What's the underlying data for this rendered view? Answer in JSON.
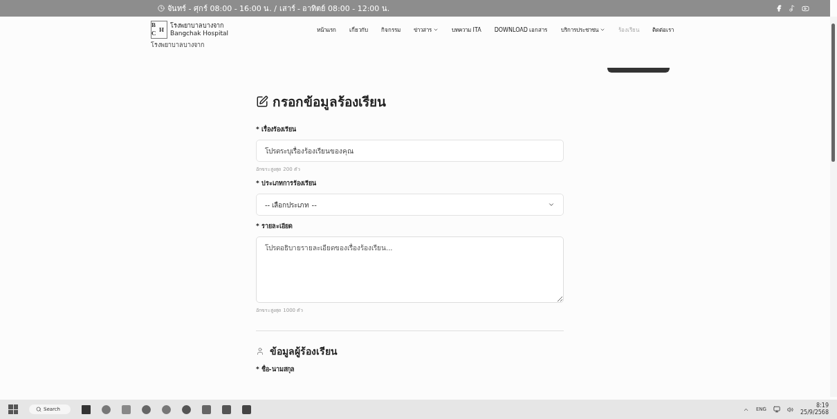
{
  "top_bar": {
    "hours": "จันทร์ - ศุกร์ 08:00 - 16:00 น. / เสาร์ - อาทิตย์ 08:00 - 12:00 น."
  },
  "logo": {
    "mark_top": "B",
    "mark_bottom": "C",
    "mark_side": "H",
    "name_th": "โรงพยาบาลบางจาก",
    "name_en": "Bangchak Hospital"
  },
  "nav": [
    {
      "label": "หน้าแรก",
      "dropdown": false,
      "selected": false
    },
    {
      "label": "เกี่ยวกับ",
      "dropdown": false,
      "selected": false
    },
    {
      "label": "กิจกรรม",
      "dropdown": false,
      "selected": false
    },
    {
      "label": "ข่าวสาร",
      "dropdown": true,
      "selected": false
    },
    {
      "label": "บทความ ITA",
      "dropdown": false,
      "selected": false
    },
    {
      "label": "DOWNLOAD เอกสาร",
      "dropdown": false,
      "selected": false
    },
    {
      "label": "บริการประชาชน",
      "dropdown": true,
      "selected": false
    },
    {
      "label": "ร้องเรียน",
      "dropdown": false,
      "selected": true
    },
    {
      "label": "ติดต่อเรา",
      "dropdown": false,
      "selected": false
    }
  ],
  "breadcrumb": "โรงพยาบาลบางจาก",
  "form": {
    "title": "กรอกข้อมูลร้องเรียน",
    "fields": [
      {
        "kind": "text",
        "label": "* เรื่องร้องเรียน",
        "placeholder": "โปรดระบุเรื่องร้องเรียนของคุณ",
        "hint": "อักขระสูงสุด 200 ตัว"
      },
      {
        "kind": "select",
        "label": "* ประเภทการร้องเรียน",
        "placeholder": "-- เลือกประเภท --"
      },
      {
        "kind": "textarea",
        "label": "* รายละเอียด",
        "placeholder": "โปรดอธิบายรายละเอียดของเรื่องร้องเรียน...",
        "hint": "อักขระสูงสุด 1000 ตัว"
      }
    ],
    "section_title": "ข้อมูลผู้ร้องเรียน",
    "section_fields": [
      {
        "label": "* ชื่อ-นามสกุล"
      }
    ]
  },
  "taskbar": {
    "search": "Search",
    "language": "ENG",
    "time": "8:19",
    "date": "25/9/2568"
  }
}
